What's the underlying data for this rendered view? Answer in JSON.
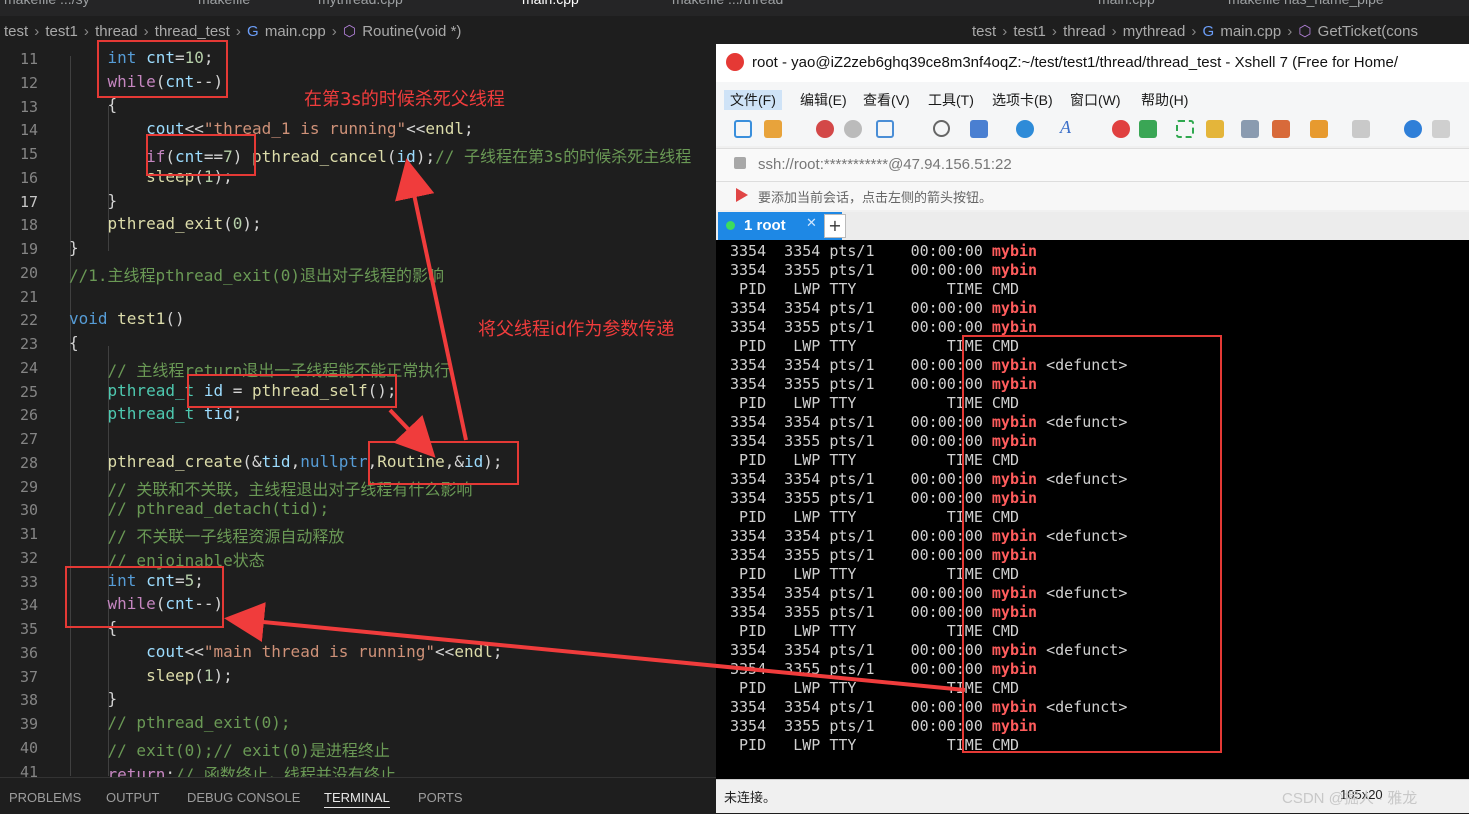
{
  "vscode": {
    "tabs": [
      "makefile .../sy",
      "makefile",
      "mythread.cpp",
      "main.cpp",
      "makefile .../thread",
      "main.cpp",
      "makefile  nas_name_pipe"
    ],
    "breadcrumb_left": [
      "test",
      "test1",
      "thread",
      "thread_test",
      "main.cpp",
      "Routine(void *)"
    ],
    "breadcrumb_right": [
      "test",
      "test1",
      "thread",
      "mythread",
      "main.cpp",
      "GetTicket(cons"
    ],
    "line_numbers": [
      "11",
      "12",
      "13",
      "14",
      "15",
      "16",
      "17",
      "18",
      "19",
      "20",
      "21",
      "22",
      "23",
      "24",
      "25",
      "26",
      "27",
      "28",
      "29",
      "30",
      "31",
      "32",
      "33",
      "34",
      "35",
      "36",
      "37",
      "38",
      "39",
      "40",
      "41"
    ],
    "current_line": "17",
    "panel_tabs": [
      "PROBLEMS",
      "OUTPUT",
      "DEBUG CONSOLE",
      "TERMINAL",
      "PORTS"
    ],
    "active_panel": "TERMINAL"
  },
  "xshell": {
    "title": "root - yao@iZ2zeb6ghq39ce8m3nf4oqZ:~/test/test1/thread/thread_test - Xshell 7 (Free for Home/",
    "menu": [
      "文件(F)",
      "编辑(E)",
      "查看(V)",
      "工具(T)",
      "选项卡(B)",
      "窗口(W)",
      "帮助(H)"
    ],
    "address": "ssh://root:***********@47.94.156.51:22",
    "note": "要添加当前会话，点击左侧的箭头按钮。",
    "tab_label": "1 root",
    "status": "未连接。",
    "status_right": "105x20",
    "terminal_lines": [
      {
        "a": "3354  3354 pts/1    00:00:00 ",
        "b": "mybin",
        "c": ""
      },
      {
        "a": "3354  3355 pts/1    00:00:00 ",
        "b": "mybin",
        "c": ""
      },
      {
        "a": " PID   LWP TTY          TIME CMD",
        "b": "",
        "c": ""
      },
      {
        "a": "3354  3354 pts/1    00:00:00 ",
        "b": "mybin",
        "c": ""
      },
      {
        "a": "3354  3355 pts/1    00:00:00 ",
        "b": "mybin",
        "c": ""
      },
      {
        "a": " PID   LWP TTY          TIME CMD",
        "b": "",
        "c": ""
      },
      {
        "a": "3354  3354 pts/1    00:00:00 ",
        "b": "mybin",
        "c": " <defunct>"
      },
      {
        "a": "3354  3355 pts/1    00:00:00 ",
        "b": "mybin",
        "c": ""
      },
      {
        "a": " PID   LWP TTY          TIME CMD",
        "b": "",
        "c": ""
      },
      {
        "a": "3354  3354 pts/1    00:00:00 ",
        "b": "mybin",
        "c": " <defunct>"
      },
      {
        "a": "3354  3355 pts/1    00:00:00 ",
        "b": "mybin",
        "c": ""
      },
      {
        "a": " PID   LWP TTY          TIME CMD",
        "b": "",
        "c": ""
      },
      {
        "a": "3354  3354 pts/1    00:00:00 ",
        "b": "mybin",
        "c": " <defunct>"
      },
      {
        "a": "3354  3355 pts/1    00:00:00 ",
        "b": "mybin",
        "c": ""
      },
      {
        "a": " PID   LWP TTY          TIME CMD",
        "b": "",
        "c": ""
      },
      {
        "a": "3354  3354 pts/1    00:00:00 ",
        "b": "mybin",
        "c": " <defunct>"
      },
      {
        "a": "3354  3355 pts/1    00:00:00 ",
        "b": "mybin",
        "c": ""
      },
      {
        "a": " PID   LWP TTY          TIME CMD",
        "b": "",
        "c": ""
      },
      {
        "a": "3354  3354 pts/1    00:00:00 ",
        "b": "mybin",
        "c": " <defunct>"
      },
      {
        "a": "3354  3355 pts/1    00:00:00 ",
        "b": "mybin",
        "c": ""
      },
      {
        "a": " PID   LWP TTY          TIME CMD",
        "b": "",
        "c": ""
      },
      {
        "a": "3354  3354 pts/1    00:00:00 ",
        "b": "mybin",
        "c": " <defunct>"
      },
      {
        "a": "3354  3355 pts/1    00:00:00 ",
        "b": "mybin",
        "c": ""
      },
      {
        "a": " PID   LWP TTY          TIME CMD",
        "b": "",
        "c": ""
      },
      {
        "a": "3354  3354 pts/1    00:00:00 ",
        "b": "mybin",
        "c": " <defunct>"
      },
      {
        "a": "3354  3355 pts/1    00:00:00 ",
        "b": "mybin",
        "c": ""
      },
      {
        "a": " PID   LWP TTY          TIME CMD",
        "b": "",
        "c": ""
      }
    ]
  },
  "annotations": {
    "kill_note": "在第3s的时候杀死父线程",
    "pass_note": "将父线程id作为参数传递"
  },
  "watermark": "CSDN @掘人 · 雅龙",
  "colors": {
    "annotation": "#e53935",
    "terminal_highlight": "#ff5c5c"
  }
}
